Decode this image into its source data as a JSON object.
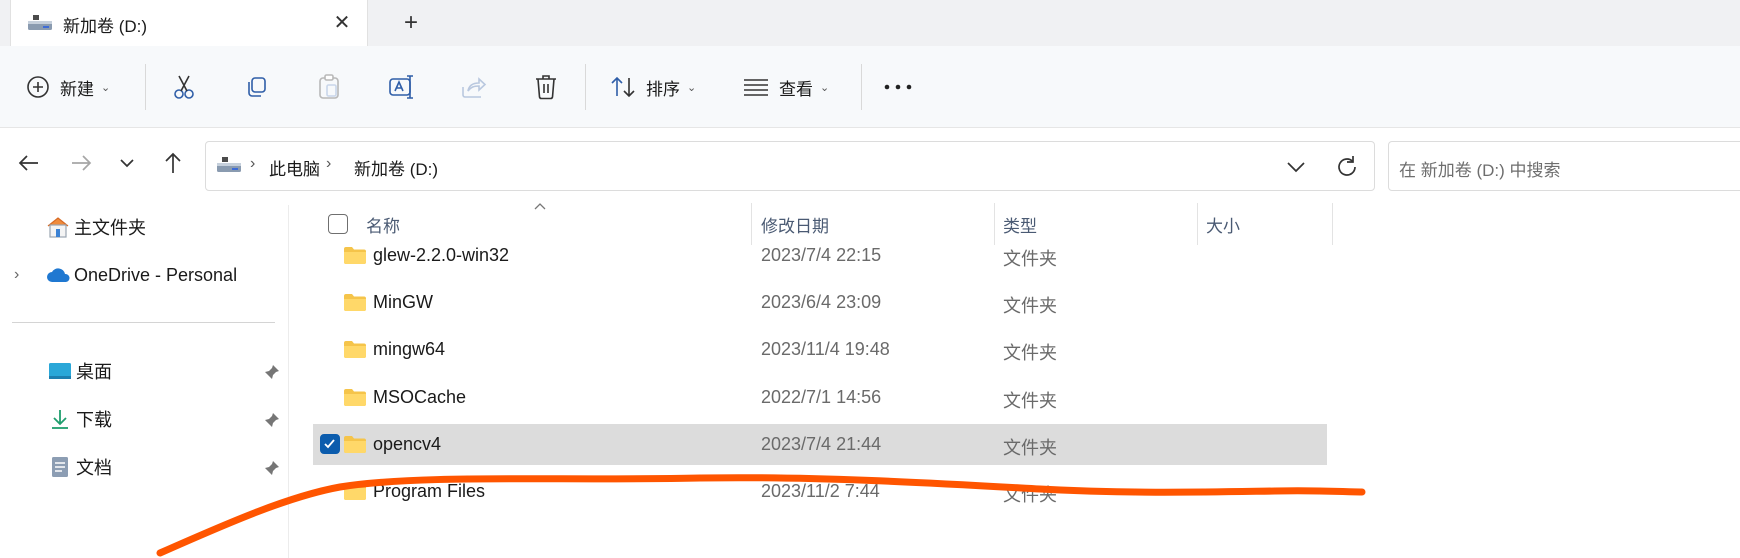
{
  "tab": {
    "title": "新加卷 (D:)",
    "close_glyph": "✕",
    "new_tab_glyph": "+"
  },
  "toolbar": {
    "new_label": "新建",
    "sort_label": "排序",
    "view_label": "查看",
    "more_glyph": "···",
    "icons": [
      "add-circle-icon",
      "cut-icon",
      "copy-icon",
      "paste-icon",
      "rename-icon",
      "share-icon",
      "delete-icon",
      "sort-icon",
      "view-icon",
      "more-icon"
    ]
  },
  "nav": {
    "back": "←",
    "forward": "→",
    "recent": "⌄",
    "up": "↑"
  },
  "address": {
    "crumbs": [
      "此电脑",
      "新加卷 (D:)"
    ],
    "separator": "›"
  },
  "search": {
    "placeholder": "在 新加卷 (D:) 中搜索"
  },
  "sidebar": {
    "home": "主文件夹",
    "onedrive": "OneDrive - Personal",
    "quick": [
      {
        "label": "桌面",
        "icon": "desktop-icon"
      },
      {
        "label": "下载",
        "icon": "download-icon"
      },
      {
        "label": "文档",
        "icon": "document-icon"
      }
    ]
  },
  "columns": {
    "name": "名称",
    "modified": "修改日期",
    "type": "类型",
    "size": "大小"
  },
  "files": [
    {
      "name": "glew-2.2.0-win32",
      "modified": "2023/7/4 22:15",
      "type": "文件夹",
      "selected": false
    },
    {
      "name": "MinGW",
      "modified": "2023/6/4 23:09",
      "type": "文件夹",
      "selected": false
    },
    {
      "name": "mingw64",
      "modified": "2023/11/4 19:48",
      "type": "文件夹",
      "selected": false
    },
    {
      "name": "MSOCache",
      "modified": "2022/7/1 14:56",
      "type": "文件夹",
      "selected": false
    },
    {
      "name": "opencv4",
      "modified": "2023/7/4 21:44",
      "type": "文件夹",
      "selected": true
    },
    {
      "name": "Program Files",
      "modified": "2023/11/2 7:44",
      "type": "文件夹",
      "selected": false
    }
  ],
  "colors": {
    "accent": "#0b5cad",
    "annotation": "#ff5500",
    "selection": "#dcdcdc"
  }
}
